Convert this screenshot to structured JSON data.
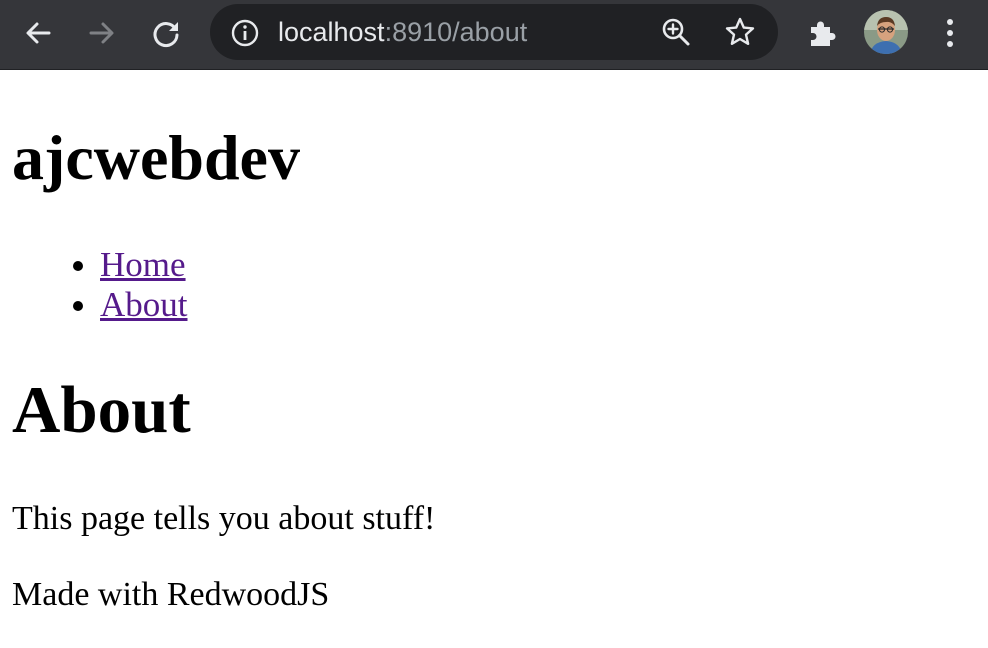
{
  "browser": {
    "url_host": "localhost",
    "url_rest": ":8910/about",
    "icons": {
      "back": "back-arrow-icon",
      "forward": "forward-arrow-icon",
      "reload": "reload-icon",
      "info": "site-info-icon",
      "zoom": "zoom-in-icon",
      "bookmark": "bookmark-star-icon",
      "extensions": "puzzle-piece-icon",
      "menu": "three-dot-menu-icon"
    },
    "colors": {
      "toolbar": "#35363a",
      "omnibox": "#202124",
      "icon_active": "#e8eaed",
      "icon_disabled": "#7f8185"
    }
  },
  "page": {
    "site_title": "ajcwebdev",
    "nav": [
      {
        "label": "Home"
      },
      {
        "label": "About"
      }
    ],
    "heading": "About",
    "body_text": "This page tells you about stuff!",
    "footer_text": "Made with RedwoodJS",
    "colors": {
      "link_visited": "#551a8b",
      "text": "#000000",
      "background": "#ffffff"
    }
  }
}
